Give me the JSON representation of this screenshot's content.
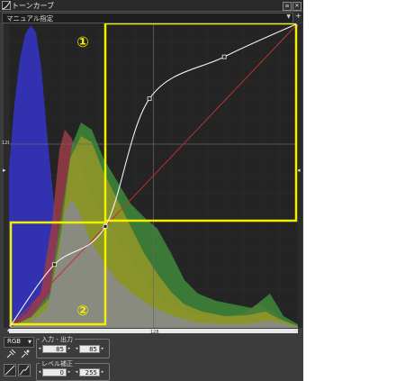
{
  "window": {
    "title": "トーンカーブ",
    "preset_label": "マニュアル指定",
    "plus_label": "+"
  },
  "graph": {
    "left_marker": "▸",
    "right_marker": "◂",
    "mid_tick_label": "128",
    "bottom_tick_label": "128",
    "callouts": [
      {
        "label": "①"
      },
      {
        "label": "②"
      }
    ],
    "colors": {
      "blue_hist": "#3434b8",
      "red_hist": "#9a3c46",
      "green_hist": "#3f8a3a",
      "yellow_hist": "#9a9a28",
      "gray_hist": "#8a8a8a",
      "highlight": "#f0f000",
      "curve": "#f2f2f2",
      "diagonal": "#c03030"
    },
    "curve_points": [
      {
        "input": 0,
        "output": 0
      },
      {
        "input": 40,
        "output": 53
      },
      {
        "input": 85,
        "output": 85
      },
      {
        "input": 124,
        "output": 192
      },
      {
        "input": 190,
        "output": 227
      },
      {
        "input": 255,
        "output": 255
      }
    ]
  },
  "controls": {
    "channel": "RGB",
    "io_group_label": "入力 - 出力",
    "input_value": "85",
    "output_value": "85",
    "level_group_label": "レベル補正",
    "level_min": "0",
    "level_max": "255"
  }
}
